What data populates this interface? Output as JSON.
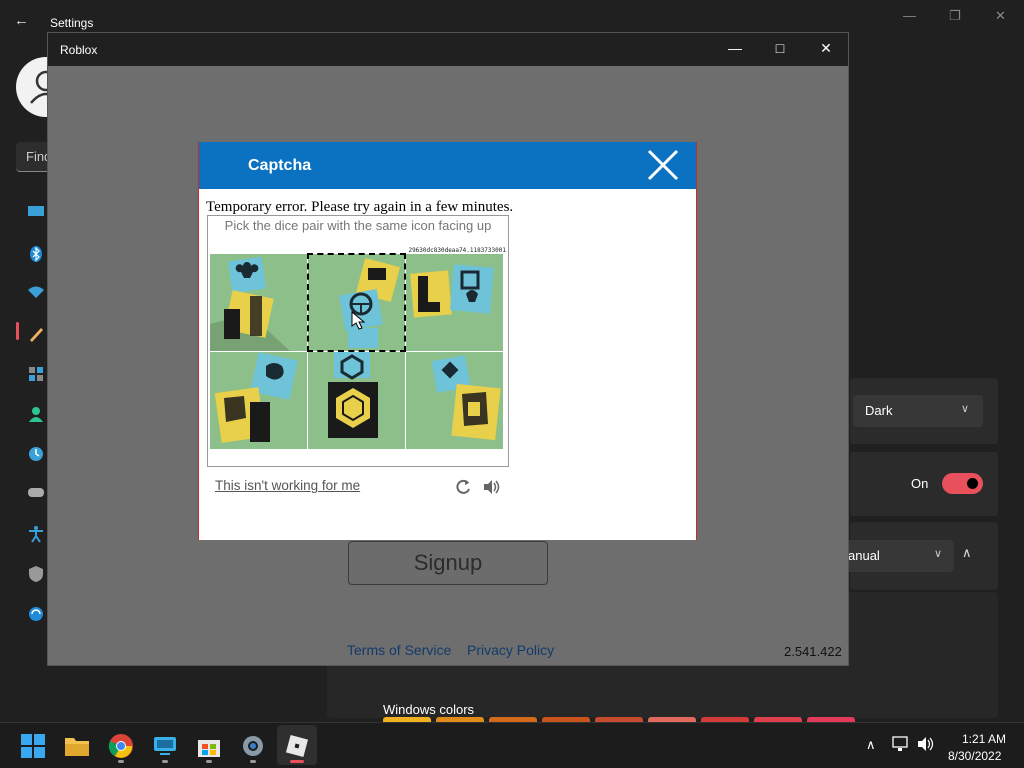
{
  "settings": {
    "title": "Settings",
    "search_placeholder": "Find",
    "theme_value": "Dark",
    "transparency_state": "On",
    "accent_value": "anual",
    "windows_colors_label": "Windows colors",
    "accent_color": "#e8505b"
  },
  "roblox": {
    "title": "Roblox",
    "signup_label": "Signup",
    "terms_link": "Terms of Service",
    "privacy_link": "Privacy Policy",
    "version": "2.541.422"
  },
  "captcha": {
    "title": "Captcha",
    "error_message": "Temporary error. Please try again in a few minutes.",
    "prompt": "Pick the dice pair with the same icon facing up",
    "puzzle_id": "29630dc830deaa74.1183733001",
    "help_link": "This isn't working for me",
    "header_color": "#0a72c1",
    "selected_tile": 2
  },
  "taskbar": {
    "time": "1:21 AM",
    "date": "8/30/2022",
    "apps": [
      "start-icon",
      "file-explorer-icon",
      "chrome-icon",
      "remote-desktop-icon",
      "store-icon",
      "settings-icon",
      "roblox-icon"
    ]
  }
}
